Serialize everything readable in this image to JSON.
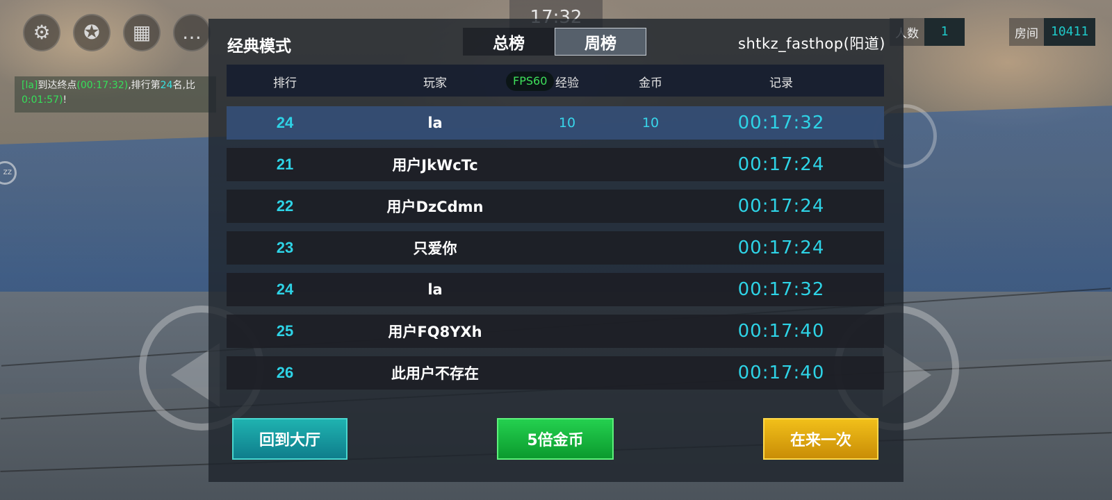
{
  "hud": {
    "clock": "17:32",
    "players_label": "人数",
    "players_value": "1",
    "room_label": "房间",
    "room_value": "10411",
    "icons": [
      "gear-icon",
      "badge-icon",
      "video-icon",
      "chat-icon",
      "pause-icon"
    ]
  },
  "chat": {
    "prefix": "[la]",
    "text1": "到达终点",
    "time": "(00:17:32)",
    "text2": ",排行第",
    "rank": "24",
    "text3": "名,比",
    "line2_time": "0:01:57)",
    "line2_end": "!"
  },
  "panel": {
    "title": "经典模式",
    "tabs": [
      {
        "label": "总榜",
        "active": false
      },
      {
        "label": "周榜",
        "active": true
      }
    ],
    "map_name": "shtkz_fasthop(阳道)",
    "columns": {
      "rank": "排行",
      "player": "玩家",
      "fps": "FPS60",
      "exp": "经验",
      "coins": "金币",
      "record": "记录"
    },
    "rows": [
      {
        "rank": "24",
        "name": "la",
        "exp": "10",
        "coins": "10",
        "record": "00:17:32",
        "me": true
      },
      {
        "rank": "21",
        "name": "用户JkWcTc",
        "exp": "",
        "coins": "",
        "record": "00:17:24"
      },
      {
        "rank": "22",
        "name": "用户DzCdmn",
        "exp": "",
        "coins": "",
        "record": "00:17:24"
      },
      {
        "rank": "23",
        "name": "只爱你",
        "exp": "",
        "coins": "",
        "record": "00:17:24"
      },
      {
        "rank": "24",
        "name": "la",
        "exp": "",
        "coins": "",
        "record": "00:17:32"
      },
      {
        "rank": "25",
        "name": "用户FQ8YXh",
        "exp": "",
        "coins": "",
        "record": "00:17:40"
      },
      {
        "rank": "26",
        "name": "此用户不存在",
        "exp": "",
        "coins": "",
        "record": "00:17:40"
      }
    ],
    "buttons": {
      "lobby": "回到大厅",
      "coins": "5倍金币",
      "again": "在来一次"
    }
  }
}
